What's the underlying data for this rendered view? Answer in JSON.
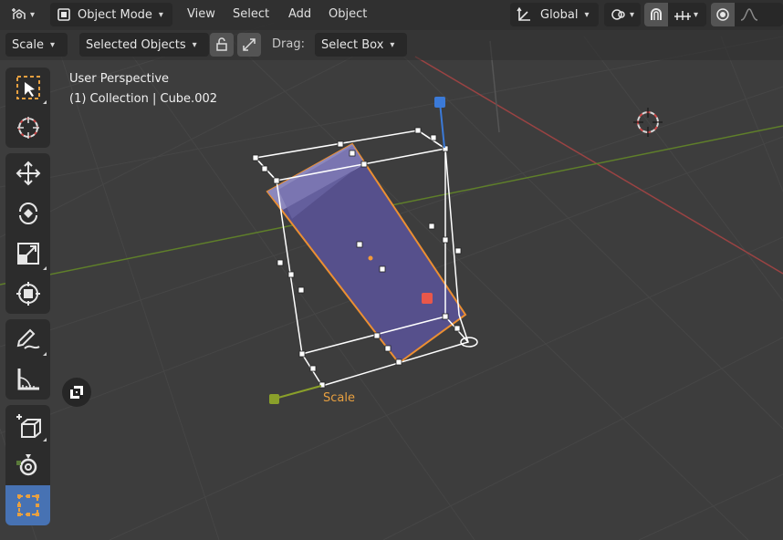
{
  "header": {
    "mode": "Object Mode",
    "menus": [
      "View",
      "Select",
      "Add",
      "Object"
    ],
    "orientation": "Global"
  },
  "tool_settings": {
    "tool": "Scale",
    "affect": "Selected Objects",
    "drag_label": "Drag:",
    "drag_mode": "Select Box"
  },
  "viewport_info": {
    "perspective": "User Perspective",
    "collection": "(1) Collection | Cube.002"
  },
  "gizmo": {
    "label": "Scale"
  },
  "toolbar": {
    "tools": [
      "select-box",
      "cursor",
      "move",
      "rotate",
      "scale",
      "transform",
      "annotate",
      "measure",
      "add-cube",
      "spin",
      "scale-cage"
    ],
    "active": "scale-cage"
  },
  "colors": {
    "background": "#3d3d3d",
    "accent": "#4772b3",
    "selection": "#e8a040",
    "x_axis": "#b84a4a",
    "y_axis": "#6a8f2a",
    "z_axis": "#3b7ad8"
  }
}
